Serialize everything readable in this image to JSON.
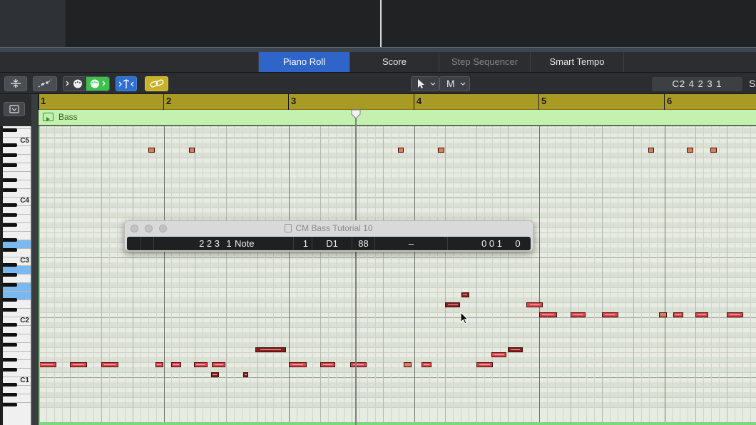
{
  "tabs": [
    {
      "label": "Piano Roll",
      "state": "active"
    },
    {
      "label": "Score",
      "state": "normal"
    },
    {
      "label": "Step Sequencer",
      "state": "disabled"
    },
    {
      "label": "Smart Tempo",
      "state": "normal"
    }
  ],
  "toolbar": {
    "pointer_tool": "pointer-icon",
    "mode_tool": "M",
    "position_display": "C2  4 2 3 1",
    "right_label": "S"
  },
  "ruler": {
    "bars": [
      "1",
      "2",
      "3",
      "4",
      "5",
      "6"
    ]
  },
  "region": {
    "name": "Bass",
    "color": "#c4f0b0"
  },
  "keyboard": {
    "octave_labels": [
      "C5",
      "C4",
      "C3",
      "C2",
      "C1"
    ]
  },
  "event_window": {
    "title": "CM Bass Tutorial 10",
    "position": "2 2 3",
    "position_sub": "1",
    "status": "Note",
    "channel": "1",
    "num": "D1",
    "val": "88",
    "length": "–",
    "length_val": "0 0 1",
    "length_ticks": "0"
  },
  "colors": {
    "note": "#e8414a",
    "note_high": "#e07b5a",
    "note_selected": "#8a1f1f",
    "ruler": "#a99a25",
    "active_tab": "#2f65c8"
  }
}
